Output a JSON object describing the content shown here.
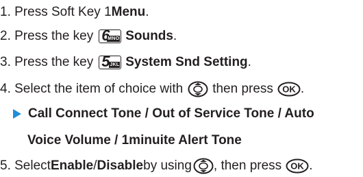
{
  "steps": [
    {
      "prefix": "1. Press Soft Key 1 ",
      "bold": "Menu",
      "suffix": "."
    },
    {
      "prefix": "2. Press the key ",
      "key_digit": "6",
      "key_letters": "MNO",
      "bold": "Sounds",
      "suffix": "."
    },
    {
      "prefix": "3. Press the key ",
      "key_digit": "5",
      "key_letters": "JKL",
      "bold": "System Snd Setting",
      "suffix": "."
    },
    {
      "prefix": "4. Select the item of choice with ",
      "mid": " then press "
    },
    {
      "prefix": "5. Select ",
      "bold1": "Enable",
      "sep": " / ",
      "bold2": "Disable",
      "mid": " by using ",
      "mid2": ", then press ",
      "suffix": "."
    }
  ],
  "options": {
    "line1": "Call Connect Tone / Out of Service Tone / Auto",
    "line2": "Voice Volume / 1minuite Alert Tone",
    "bullet_color": "#1f8fd9"
  },
  "icons": {
    "navigation_key": "nav-key-icon",
    "ok_key": "ok-key-icon",
    "ok_label": "OK"
  }
}
